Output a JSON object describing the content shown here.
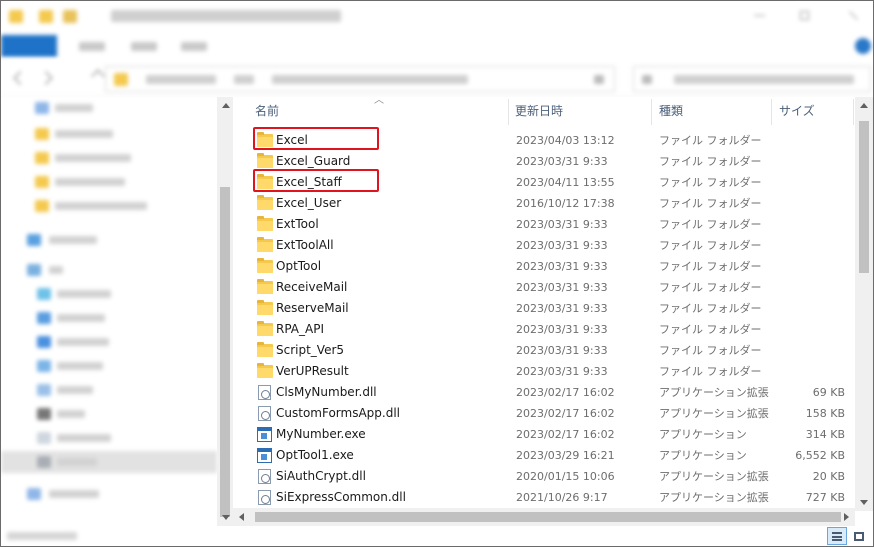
{
  "colors": {
    "folder": "#f4c94e",
    "highlight": "#e0141e",
    "header_text": "#4c607a",
    "ribbon_accent": "#1e73c8"
  },
  "columns": {
    "name": "名前",
    "date": "更新日時",
    "type": "種類",
    "size": "サイズ"
  },
  "files": [
    {
      "name": "Excel",
      "date": "2023/04/03 13:12",
      "type": "ファイル フォルダー",
      "size": "",
      "icon": "folder-icon",
      "highlighted": true
    },
    {
      "name": "Excel_Guard",
      "date": "2023/03/31 9:33",
      "type": "ファイル フォルダー",
      "size": "",
      "icon": "folder-icon",
      "highlighted": false
    },
    {
      "name": "Excel_Staff",
      "date": "2023/04/11 13:55",
      "type": "ファイル フォルダー",
      "size": "",
      "icon": "folder-icon",
      "highlighted": true
    },
    {
      "name": "Excel_User",
      "date": "2016/10/12 17:38",
      "type": "ファイル フォルダー",
      "size": "",
      "icon": "folder-icon",
      "highlighted": false
    },
    {
      "name": "ExtTool",
      "date": "2023/03/31 9:33",
      "type": "ファイル フォルダー",
      "size": "",
      "icon": "folder-icon",
      "highlighted": false
    },
    {
      "name": "ExtToolAll",
      "date": "2023/03/31 9:33",
      "type": "ファイル フォルダー",
      "size": "",
      "icon": "folder-icon",
      "highlighted": false
    },
    {
      "name": "OptTool",
      "date": "2023/03/31 9:33",
      "type": "ファイル フォルダー",
      "size": "",
      "icon": "folder-icon",
      "highlighted": false
    },
    {
      "name": "ReceiveMail",
      "date": "2023/03/31 9:33",
      "type": "ファイル フォルダー",
      "size": "",
      "icon": "folder-icon",
      "highlighted": false
    },
    {
      "name": "ReserveMail",
      "date": "2023/03/31 9:33",
      "type": "ファイル フォルダー",
      "size": "",
      "icon": "folder-icon",
      "highlighted": false
    },
    {
      "name": "RPA_API",
      "date": "2023/03/31 9:33",
      "type": "ファイル フォルダー",
      "size": "",
      "icon": "folder-icon",
      "highlighted": false
    },
    {
      "name": "Script_Ver5",
      "date": "2023/03/31 9:33",
      "type": "ファイル フォルダー",
      "size": "",
      "icon": "folder-icon",
      "highlighted": false
    },
    {
      "name": "VerUPResult",
      "date": "2023/03/31 9:33",
      "type": "ファイル フォルダー",
      "size": "",
      "icon": "folder-icon",
      "highlighted": false
    },
    {
      "name": "ClsMyNumber.dll",
      "date": "2023/02/17 16:02",
      "type": "アプリケーション拡張",
      "size": "69 KB",
      "icon": "dll-icon",
      "highlighted": false
    },
    {
      "name": "CustomFormsApp.dll",
      "date": "2023/02/17 16:02",
      "type": "アプリケーション拡張",
      "size": "158 KB",
      "icon": "dll-icon",
      "highlighted": false
    },
    {
      "name": "MyNumber.exe",
      "date": "2023/02/17 16:02",
      "type": "アプリケーション",
      "size": "314 KB",
      "icon": "exe-icon",
      "highlighted": false
    },
    {
      "name": "OptTool1.exe",
      "date": "2023/03/29 16:21",
      "type": "アプリケーション",
      "size": "6,552 KB",
      "icon": "exe-icon",
      "highlighted": false
    },
    {
      "name": "SiAuthCrypt.dll",
      "date": "2020/01/15 10:06",
      "type": "アプリケーション拡張",
      "size": "20 KB",
      "icon": "dll-icon",
      "highlighted": false
    },
    {
      "name": "SiExpressCommon.dll",
      "date": "2021/10/26 9:17",
      "type": "アプリケーション拡張",
      "size": "727 KB",
      "icon": "dll-icon",
      "highlighted": false
    }
  ]
}
